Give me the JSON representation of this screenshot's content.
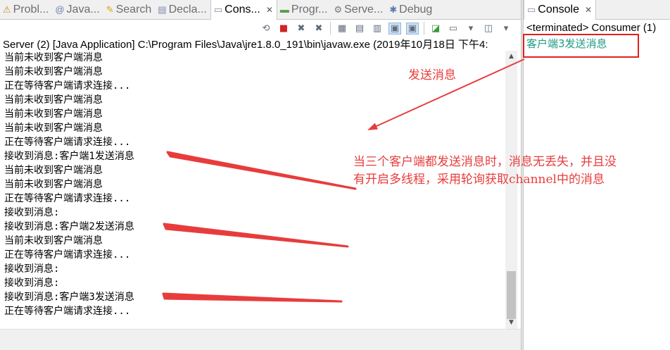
{
  "tabs": [
    {
      "label": "Probl...",
      "icon": "problems-icon",
      "active": false,
      "icon_char": "⚠"
    },
    {
      "label": "Java...",
      "icon": "javadoc-icon",
      "active": false,
      "icon_char": "@"
    },
    {
      "label": "Search",
      "icon": "search-icon",
      "active": false,
      "icon_char": "✎"
    },
    {
      "label": "Decla...",
      "icon": "declaration-icon",
      "active": false,
      "icon_char": "▤"
    },
    {
      "label": "Cons...",
      "icon": "console-icon",
      "active": true,
      "icon_char": "▭"
    },
    {
      "label": "Progr...",
      "icon": "progress-icon",
      "active": false,
      "icon_char": "▬"
    },
    {
      "label": "Serve...",
      "icon": "servers-icon",
      "active": false,
      "icon_char": "⚙"
    },
    {
      "label": "Debug",
      "icon": "debug-icon",
      "active": false,
      "icon_char": "✱"
    }
  ],
  "right_tab": {
    "label": "Console",
    "icon": "console-icon"
  },
  "process_line": "Server (2) [Java Application] C:\\Program Files\\Java\\jre1.8.0_191\\bin\\javaw.exe (2019年10月18日 下午4:",
  "console_lines": [
    "当前未收到客户端消息",
    "当前未收到客户端消息",
    "正在等待客户端请求连接...",
    "当前未收到客户端消息",
    "当前未收到客户端消息",
    "当前未收到客户端消息",
    "正在等待客户端请求连接...",
    "接收到消息:客户端1发送消息",
    "当前未收到客户端消息",
    "当前未收到客户端消息",
    "正在等待客户端请求连接...",
    "接收到消息:",
    "接收到消息:客户端2发送消息",
    "当前未收到客户端消息",
    "正在等待客户端请求连接...",
    "接收到消息:",
    "接收到消息:",
    "接收到消息:客户端3发送消息",
    "正在等待客户端请求连接..."
  ],
  "right_console": {
    "status": "<terminated> Consumer (1)",
    "output": "客户端3发送消息"
  },
  "annotations": {
    "send_label": "发送消息",
    "main_note_line1": "当三个客户端都发送消息时，消息无丢失，并且没",
    "main_note_line2": "有开启多线程，采用轮询获取channel中的消息"
  },
  "colors": {
    "annotation": "#e83c3c",
    "right_output": "#1e9a86",
    "highlight_box": "#e02020"
  }
}
